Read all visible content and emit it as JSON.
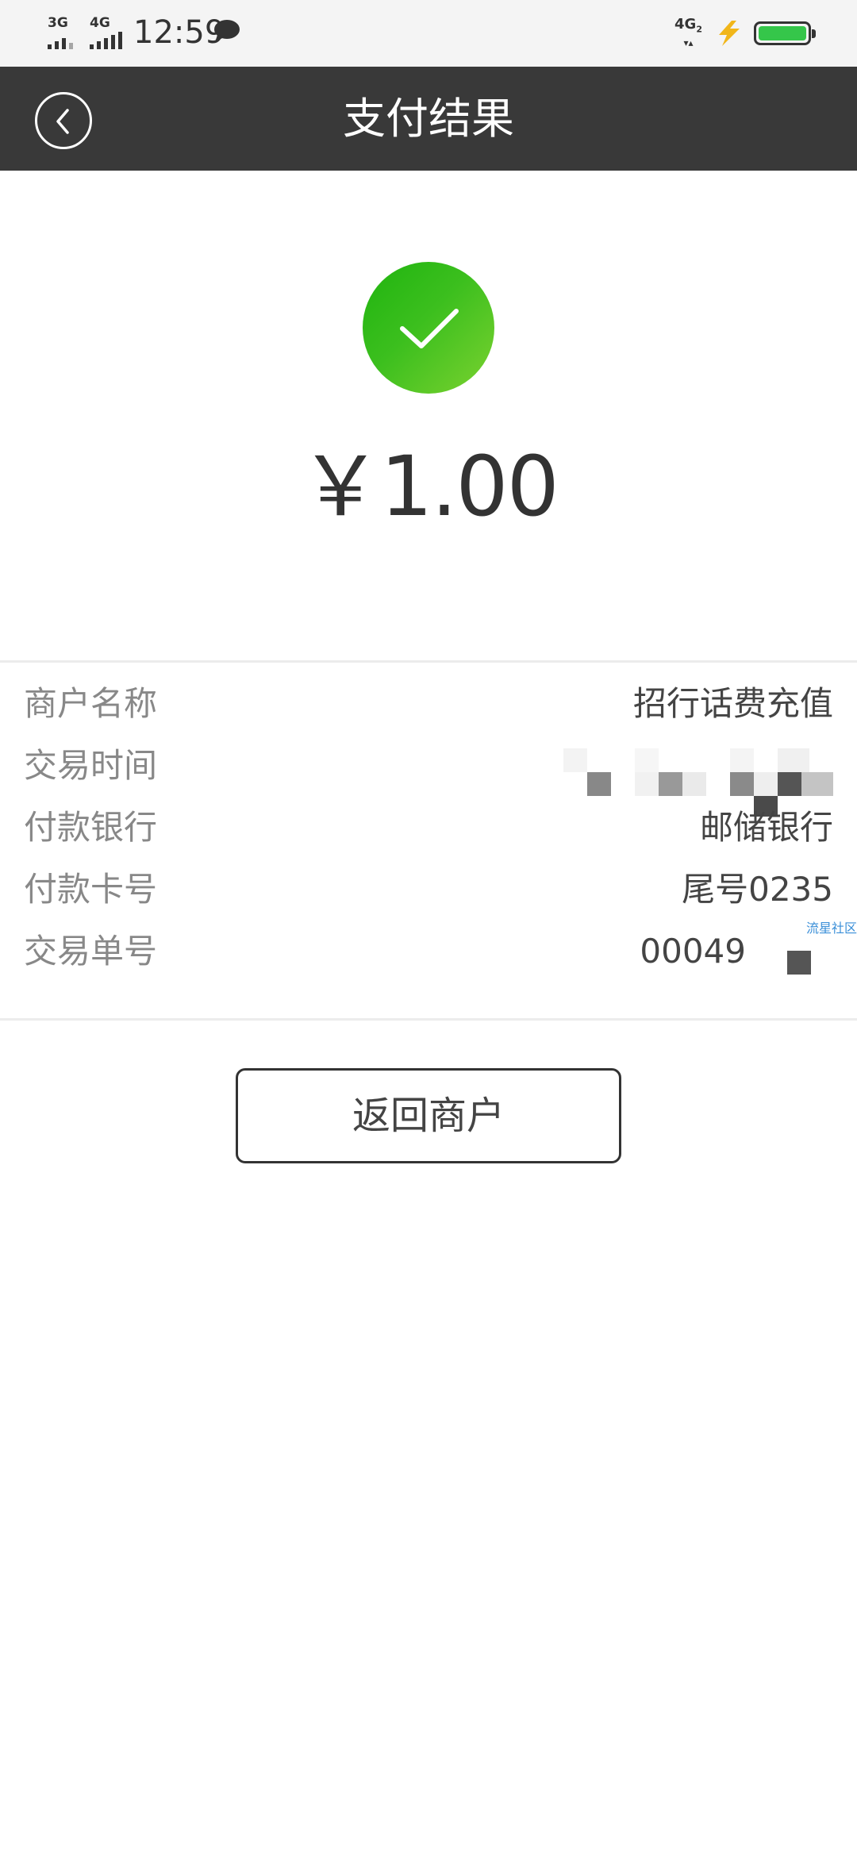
{
  "status_bar": {
    "network_1": "3G",
    "network_2": "4G",
    "time": "12:59",
    "right_network": "4G",
    "right_network_sub": "2",
    "battery_level": 1.0,
    "icons": [
      "signal-icon",
      "message-bubble-icon",
      "volte-icon",
      "charging-icon",
      "battery-icon"
    ]
  },
  "header": {
    "title": "支付结果"
  },
  "result": {
    "status_icon": "checkmark-icon",
    "status_color": "#2db913",
    "amount": "￥1.00"
  },
  "details": {
    "rows": [
      {
        "label": "商户名称",
        "value": "招行话费充值"
      },
      {
        "label": "交易时间",
        "value": ""
      },
      {
        "label": "付款银行",
        "value": "邮储银行"
      },
      {
        "label": "付款卡号",
        "value": "尾号0235"
      },
      {
        "label": "交易单号",
        "value": "00049"
      }
    ]
  },
  "watermark": "流星社区",
  "actions": {
    "return_label": "返回商户"
  },
  "colors": {
    "header_bg": "#393939",
    "status_bar_bg": "#f4f4f4",
    "battery": "#35c64a",
    "flash": "#f1b619"
  }
}
